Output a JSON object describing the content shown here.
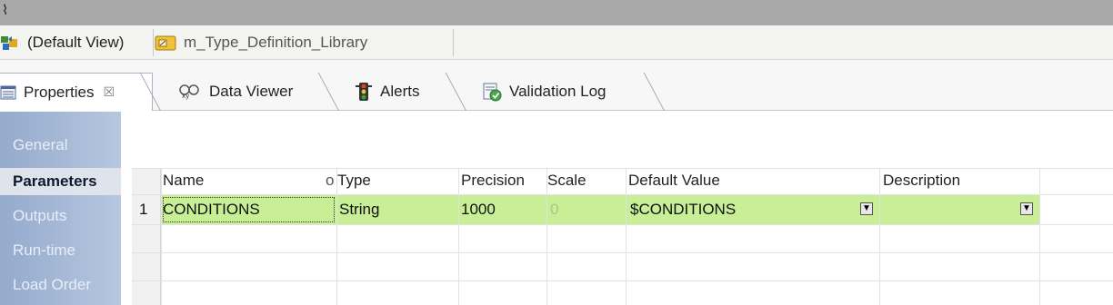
{
  "top_strip": {
    "handle_glyph": "⌇"
  },
  "breadcrumbs": [
    {
      "label": "(Default View)",
      "icon": "default-view-icon"
    },
    {
      "label": "m_Type_Definition_Library",
      "icon": "folder-icon"
    }
  ],
  "tabs": [
    {
      "label": "Properties",
      "icon": "properties-icon",
      "active": true,
      "close": "☒"
    },
    {
      "label": "Data Viewer",
      "icon": "data-viewer-icon",
      "active": false
    },
    {
      "label": "Alerts",
      "icon": "alerts-icon",
      "active": false
    },
    {
      "label": "Validation Log",
      "icon": "validation-log-icon",
      "active": false
    }
  ],
  "nav": [
    {
      "label": "General",
      "active": false
    },
    {
      "label": "Parameters",
      "active": true
    },
    {
      "label": "Outputs",
      "active": false
    },
    {
      "label": "Run-time",
      "active": false
    },
    {
      "label": "Load Order",
      "active": false
    }
  ],
  "table": {
    "columns": [
      "Name",
      "o",
      "Type",
      "Precision",
      "Scale",
      "Default Value",
      "Description"
    ],
    "rows": [
      {
        "num": "1",
        "name": "CONDITIONS",
        "type": "String",
        "precision": "1000",
        "scale": "0",
        "default_value": "$CONDITIONS",
        "description": ""
      }
    ]
  },
  "colors": {
    "row_highlight": "#c8ef96",
    "nav_bg": "#a8bbd8",
    "nav_active_bg": "#dfe4ec"
  }
}
